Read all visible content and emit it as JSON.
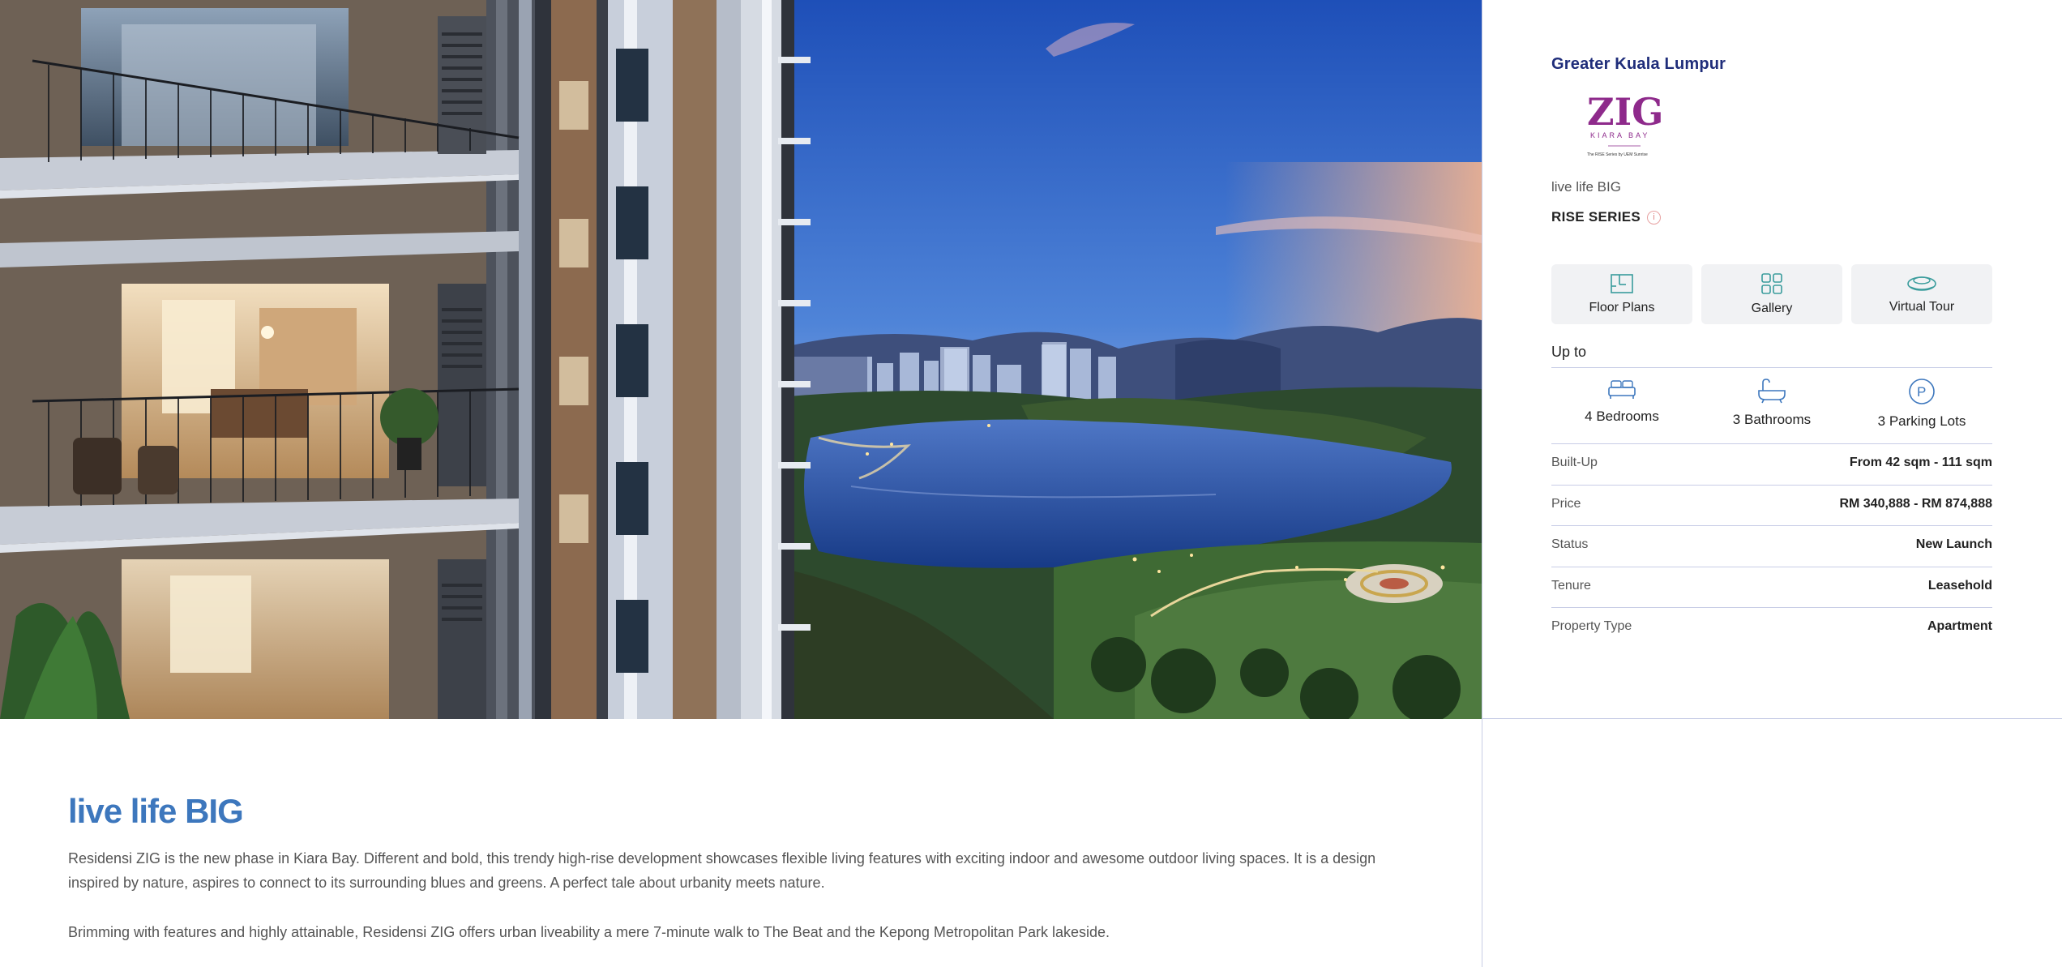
{
  "panel": {
    "region": "Greater Kuala Lumpur",
    "logo": {
      "wordmark": "ZIG",
      "subtitle": "KIARA BAY",
      "footnote": "The RISE Series by UEM Sunrise",
      "color": "#8e2a8b"
    },
    "tagline": "live life BIG",
    "series": "RISE SERIES",
    "series_info_icon": "info-icon",
    "actions": [
      {
        "label": "Floor Plans",
        "icon": "floor-plan-icon"
      },
      {
        "label": "Gallery",
        "icon": "gallery-grid-icon"
      },
      {
        "label": "Virtual Tour",
        "icon": "virtual-tour-icon"
      }
    ],
    "up_to": "Up to",
    "features": [
      {
        "label": "4 Bedrooms",
        "icon": "bed-icon"
      },
      {
        "label": "3 Bathrooms",
        "icon": "bathtub-icon"
      },
      {
        "label": "3 Parking Lots",
        "icon": "parking-icon"
      }
    ],
    "specs": [
      {
        "label": "Built-Up",
        "value": "From 42 sqm - 111 sqm"
      },
      {
        "label": "Price",
        "value": "RM 340,888 - RM 874,888"
      },
      {
        "label": "Status",
        "value": "New Launch"
      },
      {
        "label": "Tenure",
        "value": "Leasehold"
      },
      {
        "label": "Property Type",
        "value": "Apartment"
      }
    ]
  },
  "content": {
    "heading": "live life BIG",
    "paragraph1": "Residensi ZIG is the new phase in Kiara Bay. Different and bold, this trendy high-rise development showcases flexible living features with exciting indoor and awesome outdoor living spaces. It is a design inspired by nature, aspires to connect to its surrounding blues and greens. A perfect tale about urbanity meets nature.",
    "paragraph2": "Brimming with features and highly attainable, Residensi ZIG offers urban liveability a mere 7-minute walk to The Beat and the Kepong Metropolitan Park lakeside."
  },
  "colors": {
    "accent_navy": "#1f2d7a",
    "heading_blue": "#3d77bd",
    "icon_teal": "#3a9c9c",
    "divider": "#c8cde6",
    "button_bg": "#f1f2f4"
  }
}
